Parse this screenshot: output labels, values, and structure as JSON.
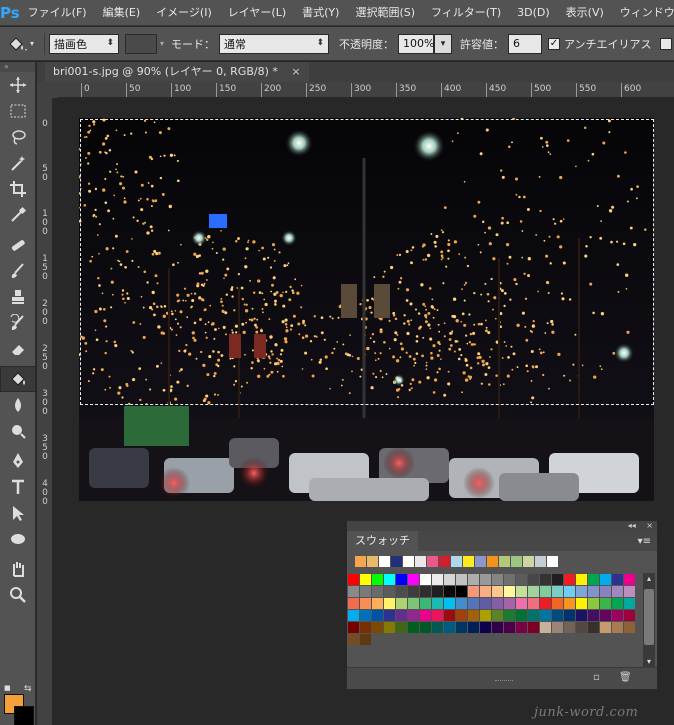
{
  "app": {
    "logo": "Ps"
  },
  "menu": [
    "ファイル(F)",
    "編集(E)",
    "イメージ(I)",
    "レイヤー(L)",
    "書式(Y)",
    "選択範囲(S)",
    "フィルター(T)",
    "3D(D)",
    "表示(V)",
    "ウィンドウ"
  ],
  "options": {
    "fill_source": "描画色",
    "mode_label": "モード：",
    "mode_value": "通常",
    "opacity_label": "不透明度：",
    "opacity_value": "100%",
    "tolerance_label": "許容値：",
    "tolerance_value": "6",
    "antialias_label": "アンチエイリアス",
    "antialias_checked": "✓"
  },
  "document": {
    "tab_title": "bri001-s.jpg @ 90% (レイヤー 0, RGB/8) *",
    "close": "×"
  },
  "ruler": {
    "h_ticks": [
      "0",
      "50",
      "100",
      "150",
      "200",
      "250",
      "300",
      "350",
      "400",
      "450",
      "500",
      "550",
      "600"
    ],
    "v_ticks": [
      "0",
      "5\n0",
      "1\n0\n0",
      "1\n5\n0",
      "2\n0\n0",
      "2\n5\n0",
      "3\n0\n0",
      "3\n5\n0",
      "4\n0\n0"
    ]
  },
  "tools": [
    {
      "name": "move-tool",
      "icon": "move-icon"
    },
    {
      "name": "marquee-tool",
      "icon": "marquee-icon"
    },
    {
      "name": "lasso-tool",
      "icon": "lasso-icon"
    },
    {
      "name": "magic-wand-tool",
      "icon": "magic-wand-icon"
    },
    {
      "name": "crop-tool",
      "icon": "crop-icon"
    },
    {
      "name": "eyedropper-tool",
      "icon": "eyedropper-icon"
    },
    {
      "name": "healing-tool",
      "icon": "healing-icon"
    },
    {
      "name": "brush-tool",
      "icon": "brush-icon"
    },
    {
      "name": "stamp-tool",
      "icon": "stamp-icon"
    },
    {
      "name": "history-brush-tool",
      "icon": "history-brush-icon"
    },
    {
      "name": "eraser-tool",
      "icon": "eraser-icon"
    },
    {
      "name": "paint-bucket-tool",
      "icon": "paint-bucket-icon",
      "active": true
    },
    {
      "name": "blur-tool",
      "icon": "blur-icon"
    },
    {
      "name": "dodge-tool",
      "icon": "dodge-icon"
    },
    {
      "name": "pen-tool",
      "icon": "pen-icon"
    },
    {
      "name": "type-tool",
      "icon": "type-icon"
    },
    {
      "name": "path-select-tool",
      "icon": "path-select-icon"
    },
    {
      "name": "shape-tool",
      "icon": "ellipse-icon"
    },
    {
      "name": "hand-tool",
      "icon": "hand-icon"
    },
    {
      "name": "zoom-tool",
      "icon": "zoom-icon"
    }
  ],
  "colors": {
    "foreground": "#f4a13c",
    "background": "#000000"
  },
  "swatches_panel": {
    "tab_label": "スウォッチ",
    "collapse": "◂◂",
    "close": "×",
    "menu": "▾≡",
    "recent": [
      "#f6a74c",
      "#e8b96a",
      "#ffffff",
      "#22307c",
      "#ffffff",
      "#e8e8e8",
      "#e85a8c",
      "#d11f2f",
      "#b1d7ea",
      "#ffeb1c",
      "#8c95cc",
      "#f3931e",
      "#b4c87a",
      "#9ec482",
      "#cdd6a3",
      "#c4ccd6",
      "#ffffff"
    ],
    "grid": [
      "#ff0000",
      "#ffff00",
      "#00ff00",
      "#00ffff",
      "#0000ff",
      "#ff00ff",
      "#ffffff",
      "#ebebeb",
      "#d6d6d6",
      "#c2c2c2",
      "#adadad",
      "#999999",
      "#858585",
      "#707070",
      "#5c5c5c",
      "#474747",
      "#333333",
      "#1f1f1f",
      "#ef1c24",
      "#fff100",
      "#00a650",
      "#00aeef",
      "#2e3192",
      "#ec008c",
      "#8a8a8a",
      "#7a7a7a",
      "#6b6b6b",
      "#5c5c5c",
      "#4d4d4d",
      "#3d3d3d",
      "#2e2e2e",
      "#1f1f1f",
      "#0a0a0a",
      "#000000",
      "#f7977a",
      "#f9ad81",
      "#fdc68a",
      "#fff79a",
      "#c4df9b",
      "#a2d39c",
      "#82ca9d",
      "#7bcdc8",
      "#6ecff6",
      "#7ea7d8",
      "#8493ca",
      "#8882be",
      "#a187be",
      "#bc8dbf",
      "#f26c4f",
      "#f68e55",
      "#fbaf5c",
      "#fff467",
      "#acd372",
      "#7cc576",
      "#3bb878",
      "#1abbb4",
      "#00bff3",
      "#438ccb",
      "#5574b9",
      "#605ca8",
      "#855fa8",
      "#a763a8",
      "#f06ea9",
      "#f26d7d",
      "#ed1c24",
      "#f26522",
      "#f7941d",
      "#fff200",
      "#8dc63f",
      "#39b54a",
      "#00a651",
      "#00a99d",
      "#00aeef",
      "#0072bc",
      "#0054a6",
      "#2e3192",
      "#662d91",
      "#92278f",
      "#ec008c",
      "#ed145b",
      "#9e0b0f",
      "#a0410d",
      "#a36209",
      "#aba000",
      "#598527",
      "#1a7b30",
      "#007236",
      "#00746b",
      "#0076a3",
      "#004b80",
      "#003471",
      "#1b1464",
      "#440e62",
      "#630460",
      "#9e005d",
      "#9e0039",
      "#790000",
      "#7b2e00",
      "#7d4900",
      "#827b00",
      "#406618",
      "#005e20",
      "#005826",
      "#005952",
      "#005b7f",
      "#003663",
      "#002157",
      "#0d004c",
      "#32004b",
      "#4b0049",
      "#7b0046",
      "#7a0026",
      "#c7b299",
      "#998675",
      "#736357",
      "#534741",
      "#37302d",
      "#c69c6d",
      "#a67c52",
      "#8c6239",
      "#754c24",
      "#603913"
    ],
    "footer_new": "▫",
    "footer_delete": "🗑"
  },
  "watermark": "junk-word.com"
}
